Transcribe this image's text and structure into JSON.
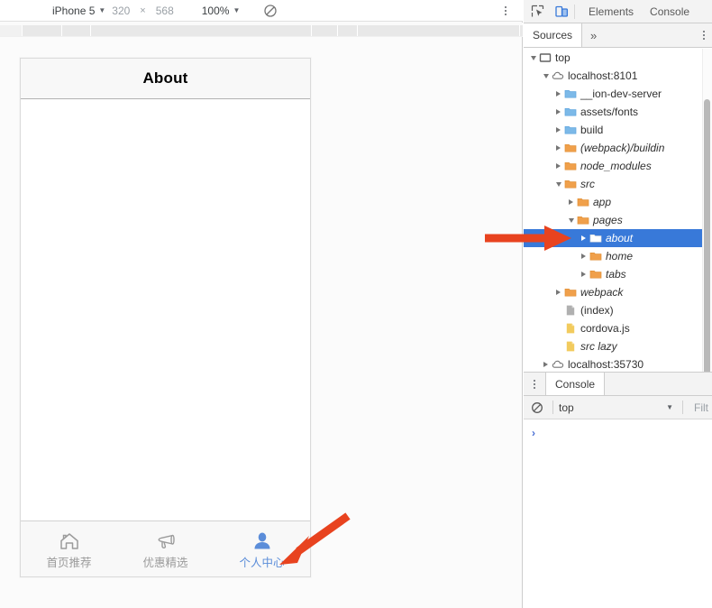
{
  "device_toolbar": {
    "device_name": "iPhone 5",
    "width": "320",
    "separator": "×",
    "height": "568",
    "zoom": "100%",
    "rotate_icon": "rotate-disabled-icon",
    "more_icon": "more-vertical-icon"
  },
  "phone": {
    "title": "About",
    "tabs": [
      {
        "label": "首页推荐",
        "icon": "home-icon",
        "active": false
      },
      {
        "label": "优惠精选",
        "icon": "megaphone-icon",
        "active": false
      },
      {
        "label": "个人中心",
        "icon": "person-icon",
        "active": true
      }
    ],
    "active_color": "#5b8dd9",
    "inactive_color": "#9b9b9b"
  },
  "devtools": {
    "inspect_icon": "inspect-element-icon",
    "device_toggle_icon": "device-toolbar-icon",
    "main_tabs": [
      {
        "label": "Elements"
      },
      {
        "label": "Console"
      }
    ],
    "panel_tabs": [
      {
        "label": "Sources",
        "selected": true
      }
    ],
    "more_tabs_label": "»",
    "kebab_icon": "more-vertical-icon",
    "selection_color": "#3879d9"
  },
  "file_tree": [
    {
      "label": "top",
      "indent": 0,
      "twisty": "down",
      "icon": "frame",
      "italic": false,
      "selected": false
    },
    {
      "label": "localhost:8101",
      "indent": 1,
      "twisty": "down",
      "icon": "cloud",
      "italic": false,
      "selected": false
    },
    {
      "label": "__ion-dev-server",
      "indent": 2,
      "twisty": "right",
      "icon": "folder-blue",
      "italic": false,
      "selected": false
    },
    {
      "label": "assets/fonts",
      "indent": 2,
      "twisty": "right",
      "icon": "folder-blue",
      "italic": false,
      "selected": false
    },
    {
      "label": "build",
      "indent": 2,
      "twisty": "right",
      "icon": "folder-blue",
      "italic": false,
      "selected": false
    },
    {
      "label": "(webpack)/buildin",
      "indent": 2,
      "twisty": "right",
      "icon": "folder-orange",
      "italic": true,
      "selected": false
    },
    {
      "label": "node_modules",
      "indent": 2,
      "twisty": "right",
      "icon": "folder-orange",
      "italic": true,
      "selected": false
    },
    {
      "label": "src",
      "indent": 2,
      "twisty": "down",
      "icon": "folder-orange",
      "italic": true,
      "selected": false
    },
    {
      "label": "app",
      "indent": 3,
      "twisty": "right",
      "icon": "folder-orange",
      "italic": true,
      "selected": false
    },
    {
      "label": "pages",
      "indent": 3,
      "twisty": "down",
      "icon": "folder-orange",
      "italic": true,
      "selected": false
    },
    {
      "label": "about",
      "indent": 4,
      "twisty": "right",
      "icon": "folder-white",
      "italic": true,
      "selected": true
    },
    {
      "label": "home",
      "indent": 4,
      "twisty": "right",
      "icon": "folder-orange",
      "italic": true,
      "selected": false
    },
    {
      "label": "tabs",
      "indent": 4,
      "twisty": "right",
      "icon": "folder-orange",
      "italic": true,
      "selected": false
    },
    {
      "label": "webpack",
      "indent": 2,
      "twisty": "right",
      "icon": "folder-orange",
      "italic": true,
      "selected": false
    },
    {
      "label": "(index)",
      "indent": 2,
      "twisty": "none",
      "icon": "file-gray",
      "italic": false,
      "selected": false
    },
    {
      "label": "cordova.js",
      "indent": 2,
      "twisty": "none",
      "icon": "file-yellow",
      "italic": false,
      "selected": false
    },
    {
      "label": "src lazy",
      "indent": 2,
      "twisty": "none",
      "icon": "file-yellow",
      "italic": true,
      "selected": false
    },
    {
      "label": "localhost:35730",
      "indent": 1,
      "twisty": "right",
      "icon": "cloud",
      "italic": false,
      "selected": false
    }
  ],
  "drawer": {
    "kebab_icon": "more-vertical-icon",
    "tab_label": "Console",
    "clear_icon": "clear-console-icon",
    "context": "top",
    "context_caret": "▼",
    "filter_placeholder": "Filt",
    "prompt": "›"
  },
  "annotations": {
    "arrow_color": "#e8431f",
    "arrows": [
      {
        "name": "arrow-to-about-folder",
        "target": "about"
      },
      {
        "name": "arrow-to-personal-center-tab",
        "target": "个人中心"
      }
    ]
  }
}
